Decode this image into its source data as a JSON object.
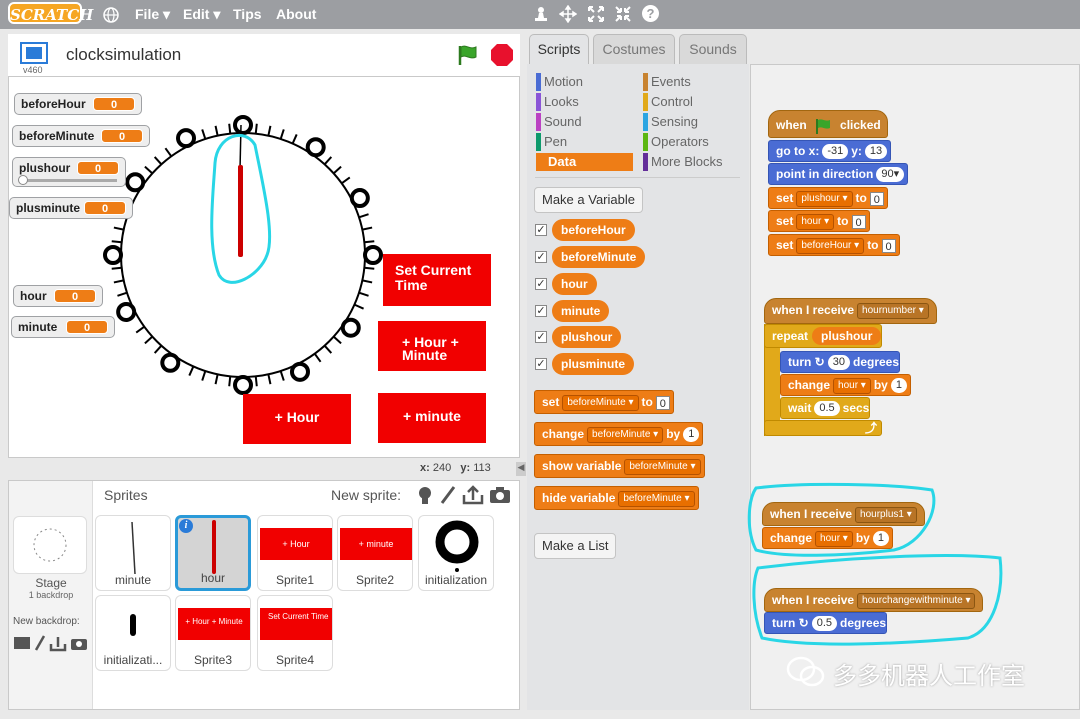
{
  "menubar": {
    "logo": "SCRATCH",
    "file": "File ▾",
    "edit": "Edit ▾",
    "tips": "Tips",
    "about": "About"
  },
  "stage": {
    "title": "clocksimulation",
    "version": "v460",
    "coords": {
      "x_label": "x:",
      "x": "240",
      "y_label": "y:",
      "y": "113"
    }
  },
  "monitors": [
    {
      "name": "beforeHour",
      "value": "0"
    },
    {
      "name": "beforeMinute",
      "value": "0"
    },
    {
      "name": "plushour",
      "value": "0"
    },
    {
      "name": "plusminute",
      "value": "0"
    },
    {
      "name": "hour",
      "value": "0"
    },
    {
      "name": "minute",
      "value": "0"
    }
  ],
  "stage_buttons": {
    "set_time": "Set Current Time",
    "hour_minute": "+ Hour + Minute",
    "hour": "+ Hour",
    "minute": "+ minute"
  },
  "sprites": {
    "title": "Sprites",
    "new_sprite": "New sprite:",
    "stage_label": "Stage",
    "backdrop_count": "1 backdrop",
    "new_backdrop": "New backdrop:",
    "items": [
      "minute",
      "hour",
      "Sprite1",
      "Sprite2",
      "initialization",
      "initializati...",
      "Sprite3",
      "Sprite4"
    ],
    "thumb_text": {
      "sprite1": "+ Hour",
      "sprite2": "+ minute",
      "sprite3": "+ Hour + Minute",
      "sprite4": "Set Current Time"
    }
  },
  "tabs": [
    "Scripts",
    "Costumes",
    "Sounds"
  ],
  "categories": [
    {
      "label": "Motion",
      "color": "#4a6cd4"
    },
    {
      "label": "Events",
      "color": "#c88330"
    },
    {
      "label": "Looks",
      "color": "#8a55d7"
    },
    {
      "label": "Control",
      "color": "#e1a91a"
    },
    {
      "label": "Sound",
      "color": "#bb42c3"
    },
    {
      "label": "Sensing",
      "color": "#2ca5e2"
    },
    {
      "label": "Pen",
      "color": "#0e9a6c"
    },
    {
      "label": "Operators",
      "color": "#5cb712"
    },
    {
      "label": "Data",
      "color": "#ee7d16"
    },
    {
      "label": "More Blocks",
      "color": "#632d99"
    }
  ],
  "palette": {
    "make_variable": "Make a Variable",
    "make_list": "Make a List",
    "variables": [
      "beforeHour",
      "beforeMinute",
      "hour",
      "minute",
      "plushour",
      "plusminute"
    ],
    "blocks": {
      "set": "set",
      "set_var": "beforeMinute",
      "to": "to",
      "set_val": "0",
      "change": "change",
      "change_var": "beforeMinute",
      "by": "by",
      "change_val": "1",
      "show": "show variable",
      "show_var": "beforeMinute",
      "hide": "hide variable",
      "hide_var": "beforeMinute"
    }
  },
  "scripts": {
    "when_clicked": {
      "when": "when",
      "clicked": "clicked"
    },
    "goto": {
      "label": "go to x:",
      "x": "-31",
      "ylabel": "y:",
      "y": "13"
    },
    "point": {
      "label": "point in direction",
      "val": "90▾"
    },
    "set1": {
      "var": "plushour",
      "val": "0"
    },
    "set2": {
      "var": "hour",
      "val": "0"
    },
    "set3": {
      "var": "beforeHour",
      "val": "0"
    },
    "receive1": {
      "label": "when I receive",
      "msg": "hournumber"
    },
    "repeat": {
      "label": "repeat",
      "var": "plushour"
    },
    "turn1": {
      "label": "turn",
      "val": "30",
      "unit": "degrees"
    },
    "change1": {
      "var": "hour",
      "val": "1"
    },
    "wait": {
      "label": "wait",
      "val": "0.5",
      "unit": "secs"
    },
    "receive2": {
      "label": "when I receive",
      "msg": "hourplus1"
    },
    "change2": {
      "var": "hour",
      "val": "1"
    },
    "receive3": {
      "label": "when I receive",
      "msg": "hourchangewithminute"
    },
    "turn2": {
      "label": "turn",
      "val": "0.5",
      "unit": "degrees"
    }
  },
  "watermark": "多多机器人工作室"
}
